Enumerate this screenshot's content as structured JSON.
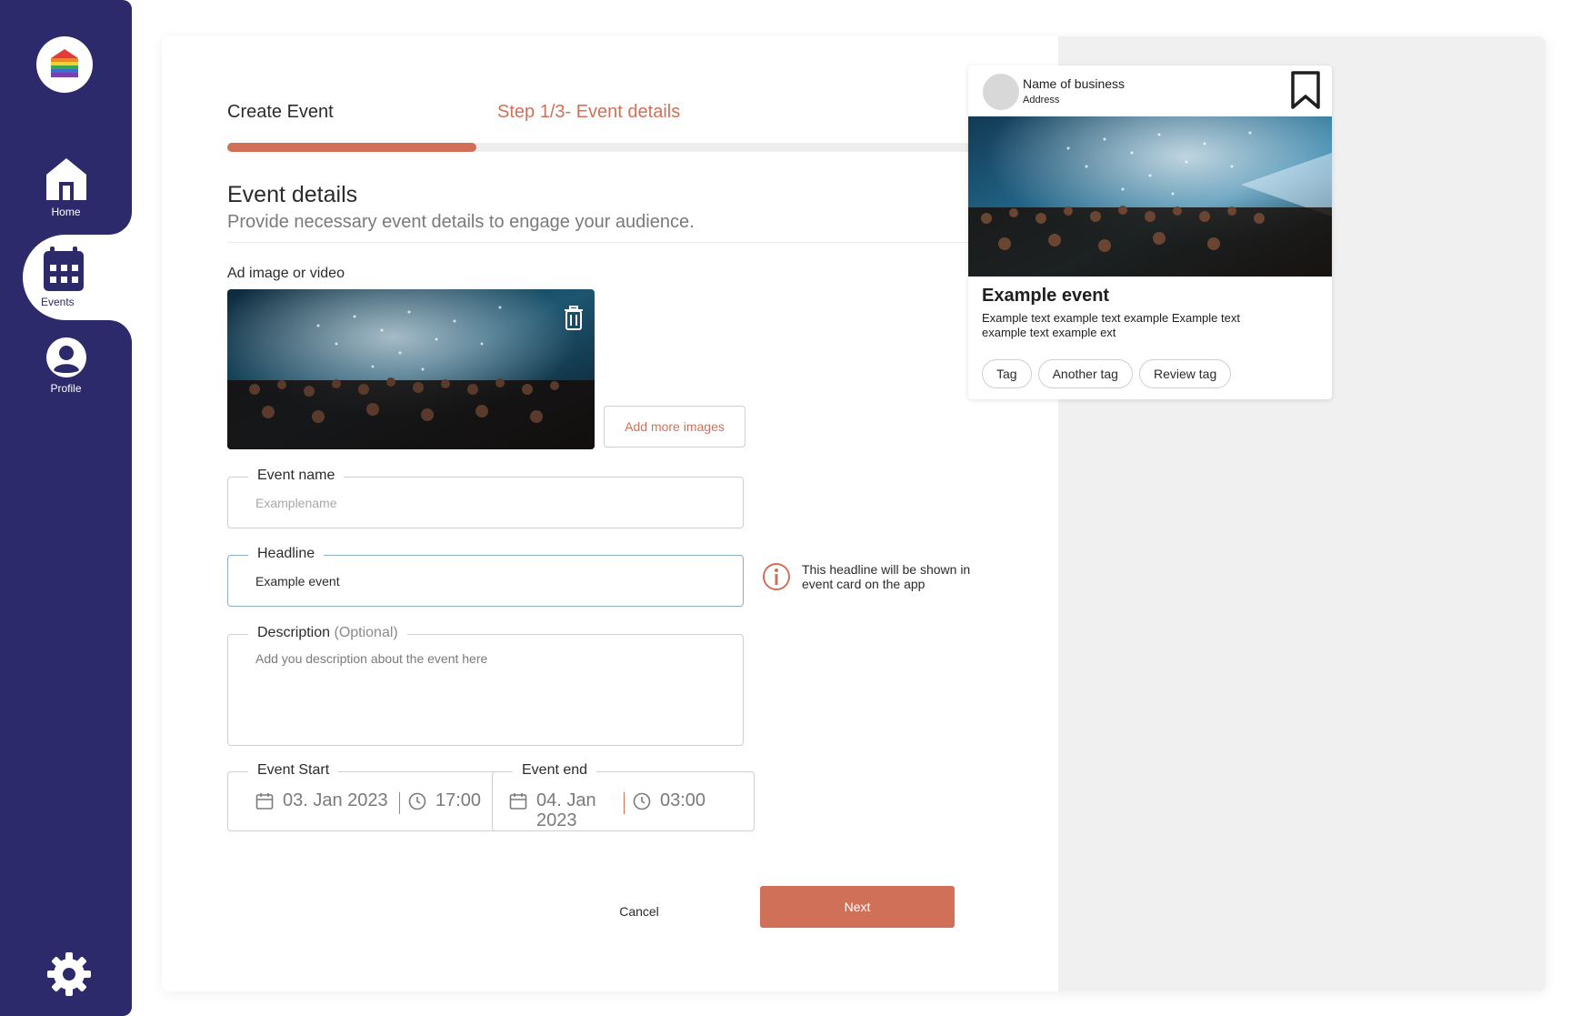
{
  "nav": {
    "logo_icon": "rainbow-house-icon",
    "items": [
      {
        "label": "Home",
        "icon": "home-icon"
      },
      {
        "label": "Events",
        "icon": "calendar-icon"
      },
      {
        "label": "Profile",
        "icon": "user-icon"
      }
    ],
    "active": "Events",
    "settings_icon": "gear-icon"
  },
  "header": {
    "title": "Create Event",
    "step": "Step 1/3- Event details",
    "progress": 0.333
  },
  "section": {
    "title": "Event details",
    "subtitle": "Provide necessary event details to engage your audience."
  },
  "ad": {
    "label": "Ad image or video",
    "add_more_label": "Add more images"
  },
  "fields": {
    "event_name": {
      "label": "Event name",
      "placeholder": "Examplename",
      "value": ""
    },
    "headline": {
      "label": "Headline",
      "value": "Example event"
    },
    "description": {
      "label": "Description",
      "optional": "(Optional)",
      "placeholder": "Add you description about the event here"
    },
    "headline_hint": "This headline will be shown in event card on the app"
  },
  "datetime": {
    "start": {
      "label": "Event Start",
      "date": "03. Jan 2023",
      "time": "17:00"
    },
    "end": {
      "label": "Event end",
      "date": "04. Jan 2023",
      "time": "03:00"
    }
  },
  "actions": {
    "cancel": "Cancel",
    "next": "Next"
  },
  "preview": {
    "business_name": "Name of business",
    "address": "Address",
    "title": "Example event",
    "text": "Example text example text example Example text example text example ext",
    "tags": [
      "Tag",
      "Another tag",
      "Review tag"
    ]
  },
  "colors": {
    "sidebar": "#2d2a6b",
    "accent": "#d07058",
    "panel": "#f0f0f0"
  }
}
